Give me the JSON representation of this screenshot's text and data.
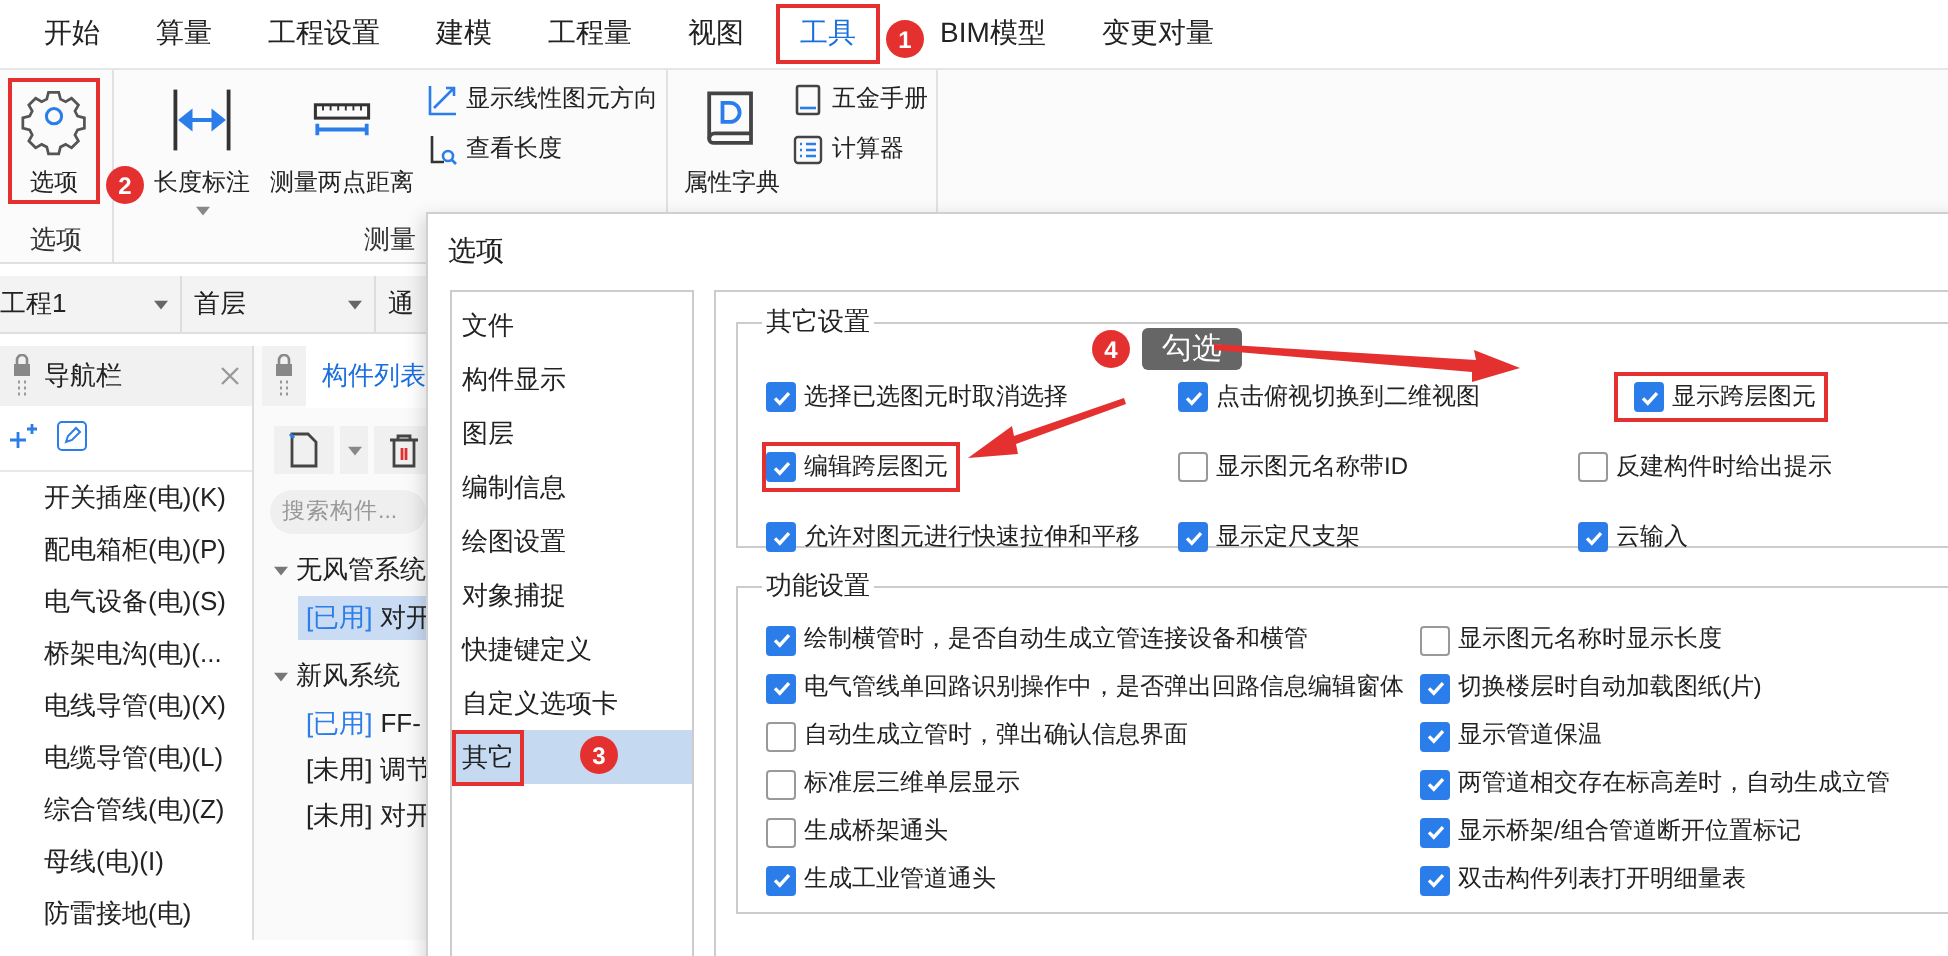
{
  "menu_tabs": [
    {
      "label": "开始",
      "selected": false,
      "highlighted": false
    },
    {
      "label": "算量",
      "selected": false,
      "highlighted": false
    },
    {
      "label": "工程设置",
      "selected": false,
      "highlighted": false
    },
    {
      "label": "建模",
      "selected": false,
      "highlighted": false
    },
    {
      "label": "工程量",
      "selected": false,
      "highlighted": false
    },
    {
      "label": "视图",
      "selected": false,
      "highlighted": false
    },
    {
      "label": "工具",
      "selected": true,
      "highlighted": true,
      "badge": "1"
    },
    {
      "label": "BIM模型",
      "selected": false,
      "highlighted": false
    },
    {
      "label": "变更对量",
      "selected": false,
      "highlighted": false
    }
  ],
  "ribbon": [
    {
      "label": "选项",
      "tools": [
        {
          "label": "选项",
          "kind": "large",
          "highlighted": true,
          "dropdown": false,
          "badge": "2"
        }
      ]
    },
    {
      "label": "测量",
      "tools": [
        {
          "label": "长度标注",
          "kind": "large",
          "highlighted": false,
          "dropdown": true
        },
        {
          "label": "测量两点距离",
          "kind": "large",
          "highlighted": false,
          "dropdown": false
        },
        {
          "label": "显示线性图元方向",
          "kind": "small"
        },
        {
          "label": "查看长度",
          "kind": "small"
        }
      ]
    },
    {
      "tools": [
        {
          "label": "属性字典",
          "kind": "large",
          "highlighted": false,
          "dropdown": false
        },
        {
          "label": "五金手册",
          "kind": "small"
        },
        {
          "label": "计算器",
          "kind": "small"
        }
      ]
    }
  ],
  "selectors": [
    {
      "value": "工程1"
    },
    {
      "value": "首层"
    },
    {
      "value": "通"
    }
  ],
  "navigation_panel": {
    "title": "导航栏",
    "items": [
      "开关插座(电)(K)",
      "配电箱柜(电)(P)",
      "电气设备(电)(S)",
      "桥架电沟(电)(...",
      "电线导管(电)(X)",
      "电缆导管(电)(L)",
      "综合管线(电)(Z)",
      "母线(电)(I)",
      "防雷接地(电)"
    ]
  },
  "component_list": {
    "title": "构件列表",
    "search": {
      "placeholder": "搜索构件..."
    },
    "tree": [
      {
        "label": "无风管系统",
        "expanded": true,
        "children": [
          {
            "status": "[已用]",
            "label": "对开",
            "used": true,
            "selected": true
          }
        ]
      },
      {
        "label": "新风系统",
        "expanded": true,
        "children": [
          {
            "status": "[已用]",
            "label": "FF-",
            "used": true,
            "selected": false
          },
          {
            "status": "[未用]",
            "label": "调节",
            "used": false,
            "selected": false
          },
          {
            "status": "[未用]",
            "label": "对开",
            "used": false,
            "selected": false
          }
        ]
      }
    ]
  },
  "dialog": {
    "title": "选项",
    "nav": [
      {
        "label": "文件",
        "selected": false,
        "highlighted": false
      },
      {
        "label": "构件显示",
        "selected": false,
        "highlighted": false
      },
      {
        "label": "图层",
        "selected": false,
        "highlighted": false
      },
      {
        "label": "编制信息",
        "selected": false,
        "highlighted": false
      },
      {
        "label": "绘图设置",
        "selected": false,
        "highlighted": false
      },
      {
        "label": "对象捕捉",
        "selected": false,
        "highlighted": false
      },
      {
        "label": "快捷键定义",
        "selected": false,
        "highlighted": false
      },
      {
        "label": "自定义选项卡",
        "selected": false,
        "highlighted": false
      },
      {
        "label": "其它",
        "selected": true,
        "highlighted": true,
        "badge": "3"
      }
    ],
    "groups": [
      {
        "title": "其它设置",
        "options": [
          {
            "label": "选择已选图元时取消选择",
            "checked": true,
            "highlighted": false
          },
          {
            "label": "点击俯视切换到二维视图",
            "checked": true,
            "highlighted": false
          },
          {
            "label": "显示跨层图元",
            "checked": true,
            "highlighted": true
          },
          {
            "label": "编辑跨层图元",
            "checked": true,
            "highlighted": true
          },
          {
            "label": "显示图元名称带ID",
            "checked": false,
            "highlighted": false
          },
          {
            "label": "反建构件时给出提示",
            "checked": false,
            "highlighted": false
          },
          {
            "label": "允许对图元进行快速拉伸和平移",
            "checked": true,
            "highlighted": false
          },
          {
            "label": "显示定尺支架",
            "checked": true,
            "highlighted": false
          },
          {
            "label": "云输入",
            "checked": true,
            "highlighted": false
          }
        ]
      },
      {
        "title": "功能设置",
        "options": [
          {
            "label": "绘制横管时，是否自动生成立管连接设备和横管",
            "checked": true,
            "highlighted": false
          },
          {
            "label": "显示图元名称时显示长度",
            "checked": false,
            "highlighted": false
          },
          {
            "label": "电气管线单回路识别操作中，是否弹出回路信息编辑窗体",
            "checked": true,
            "highlighted": false
          },
          {
            "label": "切换楼层时自动加载图纸(片)",
            "checked": true,
            "highlighted": false
          },
          {
            "label": "自动生成立管时，弹出确认信息界面",
            "checked": false,
            "highlighted": false
          },
          {
            "label": "显示管道保温",
            "checked": true,
            "highlighted": false
          },
          {
            "label": "标准层三维单层显示",
            "checked": false,
            "highlighted": false
          },
          {
            "label": "两管道相交存在标高差时，自动生成立管",
            "checked": true,
            "highlighted": false
          },
          {
            "label": "生成桥架通头",
            "checked": false,
            "highlighted": false
          },
          {
            "label": "显示桥架/组合管道断开位置标记",
            "checked": true,
            "highlighted": false
          },
          {
            "label": "生成工业管道通头",
            "checked": true,
            "highlighted": false
          },
          {
            "label": "双击构件列表打开明细量表",
            "checked": true,
            "highlighted": false
          }
        ]
      }
    ]
  },
  "callout": {
    "badge": "4",
    "label": "勾选"
  }
}
